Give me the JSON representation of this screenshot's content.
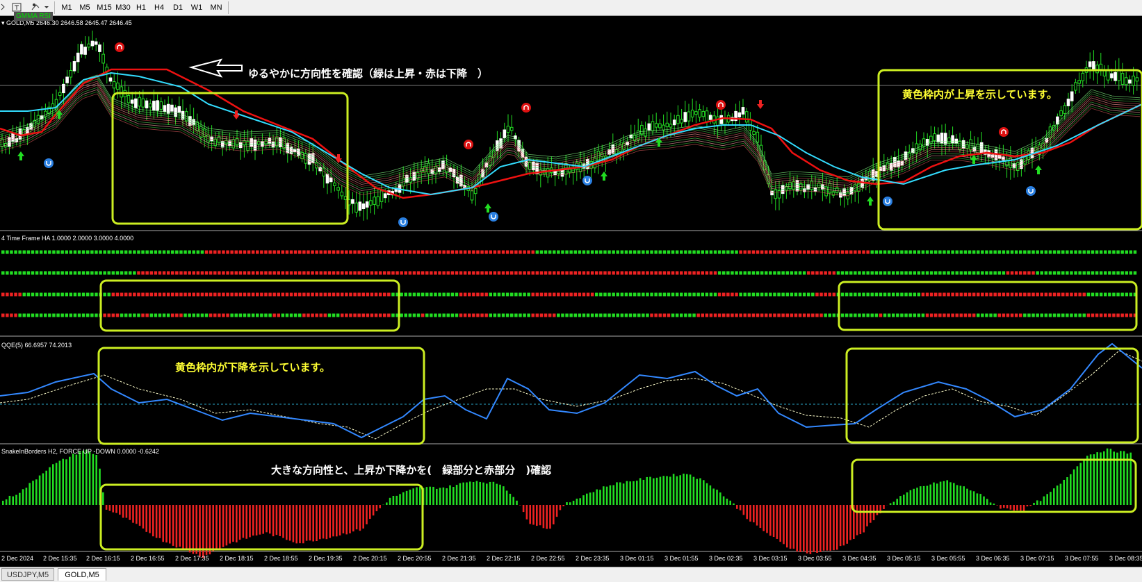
{
  "toolbar": {
    "icons": [
      "crosshair-icon",
      "period-separator-icon",
      "template-icon"
    ],
    "timeframes": [
      "M1",
      "M5",
      "M15",
      "M30",
      "H1",
      "H4",
      "D1",
      "W1",
      "MN"
    ]
  },
  "main_pane": {
    "header": "GOLD,M5  2646.30 2646.58 2645.47 2646.45",
    "indicator_badge": "GMMA RSI",
    "annotation_arrow": "ゆるやかに方向性を確認（緑は上昇・赤は下降　）",
    "annotation_yellow_box": "黄色枠内が上昇を示しています。"
  },
  "ha_pane": {
    "header": "4 Time Frame HA 1.0000 2.0000 3.0000 4.0000"
  },
  "qqe_pane": {
    "header": "QQE(5) 66.6957 74.2013",
    "annotation": "黄色枠内が下降を示しています。"
  },
  "snake_pane": {
    "header": "SnakeInBorders H2, FORCE UP -DOWN  0.0000 -0.6242",
    "annotation": "大きな方向性と、上昇か下降かを(　緑部分と赤部分　)確認"
  },
  "x_axis": {
    "labels": [
      "2 Dec 2024",
      "2 Dec 15:35",
      "2 Dec 16:15",
      "2 Dec 16:55",
      "2 Dec 17:35",
      "2 Dec 18:15",
      "2 Dec 18:55",
      "2 Dec 19:35",
      "2 Dec 20:15",
      "2 Dec 20:55",
      "2 Dec 21:35",
      "2 Dec 22:15",
      "2 Dec 22:55",
      "2 Dec 23:35",
      "3 Dec 01:15",
      "3 Dec 01:55",
      "3 Dec 02:35",
      "3 Dec 03:15",
      "3 Dec 03:55",
      "3 Dec 04:35",
      "3 Dec 05:15",
      "3 Dec 05:55",
      "3 Dec 06:35",
      "3 Dec 07:15",
      "3 Dec 07:55",
      "3 Dec 08:35"
    ]
  },
  "tabs": [
    {
      "label": "USDJPY,M5",
      "active": false
    },
    {
      "label": "GOLD,M5",
      "active": true
    }
  ],
  "colors": {
    "bull": "#22dd22",
    "bear": "#ee2222",
    "highlight_box": "#ccee22",
    "qqe_line": "#3388ff",
    "ma_cyan": "#33ddff"
  }
}
